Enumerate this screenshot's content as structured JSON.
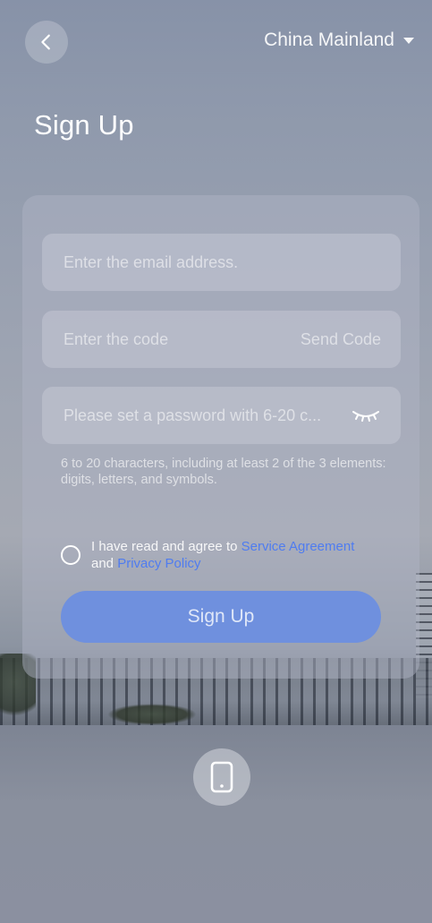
{
  "header": {
    "back_icon": "chevron-left-icon",
    "region": "China Mainland",
    "region_icon": "caret-down-icon"
  },
  "title": "Sign Up",
  "form": {
    "email": {
      "value": "",
      "placeholder": "Enter the email address."
    },
    "code": {
      "value": "",
      "placeholder": "Enter the code",
      "send_label": "Send Code"
    },
    "password": {
      "value": "",
      "placeholder": "Please set a password with 6-20 c...",
      "toggle_icon": "eye-closed-icon"
    },
    "password_hint": "6 to 20 characters, including at least 2 of the 3 elements: digits, letters, and symbols."
  },
  "agreement": {
    "checked": false,
    "prefix": "I have read and agree to ",
    "service_link": "Service Agreement",
    "conjunction": " and ",
    "privacy_link": "Privacy Policy"
  },
  "submit_label": "Sign Up",
  "alt_login_icon": "mobile-phone-icon",
  "colors": {
    "link": "#4f7cf0",
    "primary_button": "#6f90de"
  }
}
